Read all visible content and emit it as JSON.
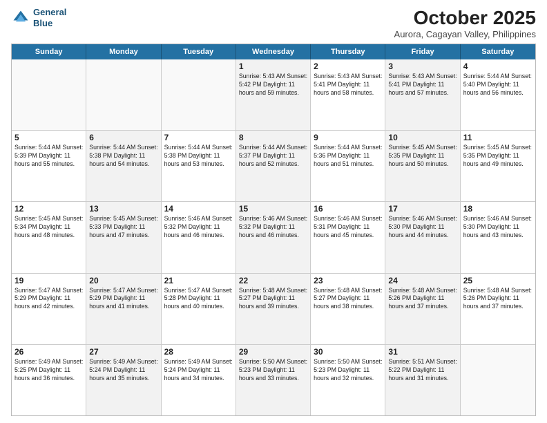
{
  "header": {
    "logo_line1": "General",
    "logo_line2": "Blue",
    "month": "October 2025",
    "location": "Aurora, Cagayan Valley, Philippines"
  },
  "days_of_week": [
    "Sunday",
    "Monday",
    "Tuesday",
    "Wednesday",
    "Thursday",
    "Friday",
    "Saturday"
  ],
  "rows": [
    [
      {
        "day": "",
        "info": "",
        "empty": true
      },
      {
        "day": "",
        "info": "",
        "empty": true
      },
      {
        "day": "",
        "info": "",
        "empty": true
      },
      {
        "day": "1",
        "info": "Sunrise: 5:43 AM\nSunset: 5:42 PM\nDaylight: 11 hours\nand 59 minutes.",
        "shaded": true
      },
      {
        "day": "2",
        "info": "Sunrise: 5:43 AM\nSunset: 5:41 PM\nDaylight: 11 hours\nand 58 minutes."
      },
      {
        "day": "3",
        "info": "Sunrise: 5:43 AM\nSunset: 5:41 PM\nDaylight: 11 hours\nand 57 minutes.",
        "shaded": true
      },
      {
        "day": "4",
        "info": "Sunrise: 5:44 AM\nSunset: 5:40 PM\nDaylight: 11 hours\nand 56 minutes."
      }
    ],
    [
      {
        "day": "5",
        "info": "Sunrise: 5:44 AM\nSunset: 5:39 PM\nDaylight: 11 hours\nand 55 minutes."
      },
      {
        "day": "6",
        "info": "Sunrise: 5:44 AM\nSunset: 5:38 PM\nDaylight: 11 hours\nand 54 minutes.",
        "shaded": true
      },
      {
        "day": "7",
        "info": "Sunrise: 5:44 AM\nSunset: 5:38 PM\nDaylight: 11 hours\nand 53 minutes."
      },
      {
        "day": "8",
        "info": "Sunrise: 5:44 AM\nSunset: 5:37 PM\nDaylight: 11 hours\nand 52 minutes.",
        "shaded": true
      },
      {
        "day": "9",
        "info": "Sunrise: 5:44 AM\nSunset: 5:36 PM\nDaylight: 11 hours\nand 51 minutes."
      },
      {
        "day": "10",
        "info": "Sunrise: 5:45 AM\nSunset: 5:35 PM\nDaylight: 11 hours\nand 50 minutes.",
        "shaded": true
      },
      {
        "day": "11",
        "info": "Sunrise: 5:45 AM\nSunset: 5:35 PM\nDaylight: 11 hours\nand 49 minutes."
      }
    ],
    [
      {
        "day": "12",
        "info": "Sunrise: 5:45 AM\nSunset: 5:34 PM\nDaylight: 11 hours\nand 48 minutes."
      },
      {
        "day": "13",
        "info": "Sunrise: 5:45 AM\nSunset: 5:33 PM\nDaylight: 11 hours\nand 47 minutes.",
        "shaded": true
      },
      {
        "day": "14",
        "info": "Sunrise: 5:46 AM\nSunset: 5:32 PM\nDaylight: 11 hours\nand 46 minutes."
      },
      {
        "day": "15",
        "info": "Sunrise: 5:46 AM\nSunset: 5:32 PM\nDaylight: 11 hours\nand 46 minutes.",
        "shaded": true
      },
      {
        "day": "16",
        "info": "Sunrise: 5:46 AM\nSunset: 5:31 PM\nDaylight: 11 hours\nand 45 minutes."
      },
      {
        "day": "17",
        "info": "Sunrise: 5:46 AM\nSunset: 5:30 PM\nDaylight: 11 hours\nand 44 minutes.",
        "shaded": true
      },
      {
        "day": "18",
        "info": "Sunrise: 5:46 AM\nSunset: 5:30 PM\nDaylight: 11 hours\nand 43 minutes."
      }
    ],
    [
      {
        "day": "19",
        "info": "Sunrise: 5:47 AM\nSunset: 5:29 PM\nDaylight: 11 hours\nand 42 minutes."
      },
      {
        "day": "20",
        "info": "Sunrise: 5:47 AM\nSunset: 5:29 PM\nDaylight: 11 hours\nand 41 minutes.",
        "shaded": true
      },
      {
        "day": "21",
        "info": "Sunrise: 5:47 AM\nSunset: 5:28 PM\nDaylight: 11 hours\nand 40 minutes."
      },
      {
        "day": "22",
        "info": "Sunrise: 5:48 AM\nSunset: 5:27 PM\nDaylight: 11 hours\nand 39 minutes.",
        "shaded": true
      },
      {
        "day": "23",
        "info": "Sunrise: 5:48 AM\nSunset: 5:27 PM\nDaylight: 11 hours\nand 38 minutes."
      },
      {
        "day": "24",
        "info": "Sunrise: 5:48 AM\nSunset: 5:26 PM\nDaylight: 11 hours\nand 37 minutes.",
        "shaded": true
      },
      {
        "day": "25",
        "info": "Sunrise: 5:48 AM\nSunset: 5:26 PM\nDaylight: 11 hours\nand 37 minutes."
      }
    ],
    [
      {
        "day": "26",
        "info": "Sunrise: 5:49 AM\nSunset: 5:25 PM\nDaylight: 11 hours\nand 36 minutes."
      },
      {
        "day": "27",
        "info": "Sunrise: 5:49 AM\nSunset: 5:24 PM\nDaylight: 11 hours\nand 35 minutes.",
        "shaded": true
      },
      {
        "day": "28",
        "info": "Sunrise: 5:49 AM\nSunset: 5:24 PM\nDaylight: 11 hours\nand 34 minutes."
      },
      {
        "day": "29",
        "info": "Sunrise: 5:50 AM\nSunset: 5:23 PM\nDaylight: 11 hours\nand 33 minutes.",
        "shaded": true
      },
      {
        "day": "30",
        "info": "Sunrise: 5:50 AM\nSunset: 5:23 PM\nDaylight: 11 hours\nand 32 minutes."
      },
      {
        "day": "31",
        "info": "Sunrise: 5:51 AM\nSunset: 5:22 PM\nDaylight: 11 hours\nand 31 minutes.",
        "shaded": true
      },
      {
        "day": "",
        "info": "",
        "empty": true
      }
    ]
  ]
}
